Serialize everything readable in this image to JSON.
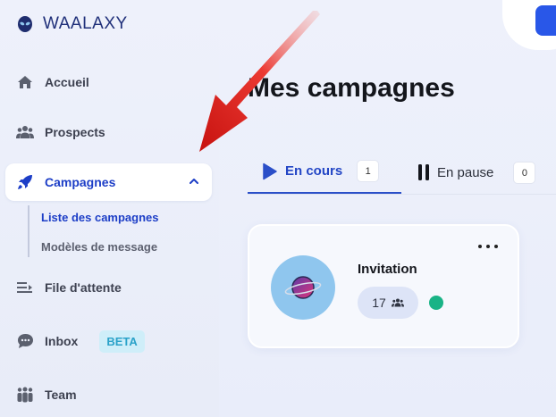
{
  "app": {
    "name": "WAALAXY"
  },
  "nav": [
    {
      "label": "Accueil",
      "icon": "home-icon"
    },
    {
      "label": "Prospects",
      "icon": "users-icon"
    },
    {
      "label": "Campagnes",
      "icon": "rocket-icon"
    },
    {
      "label": "File d'attente",
      "icon": "queue-icon"
    },
    {
      "label": "Inbox",
      "icon": "chat-icon",
      "badge": "BETA"
    },
    {
      "label": "Team",
      "icon": "team-icon"
    }
  ],
  "subnav": [
    "Liste des campagnes",
    "Modèles de message"
  ],
  "page": {
    "title": "Mes campagnes"
  },
  "tabs": [
    {
      "label": "En cours",
      "count": "1"
    },
    {
      "label": "En pause",
      "count": "0"
    }
  ],
  "campaign": {
    "name": "Invitation",
    "prospects": "17"
  },
  "colors": {
    "accent": "#1d3ec7",
    "status_active": "#19b386",
    "arrow": "#e0201c"
  }
}
